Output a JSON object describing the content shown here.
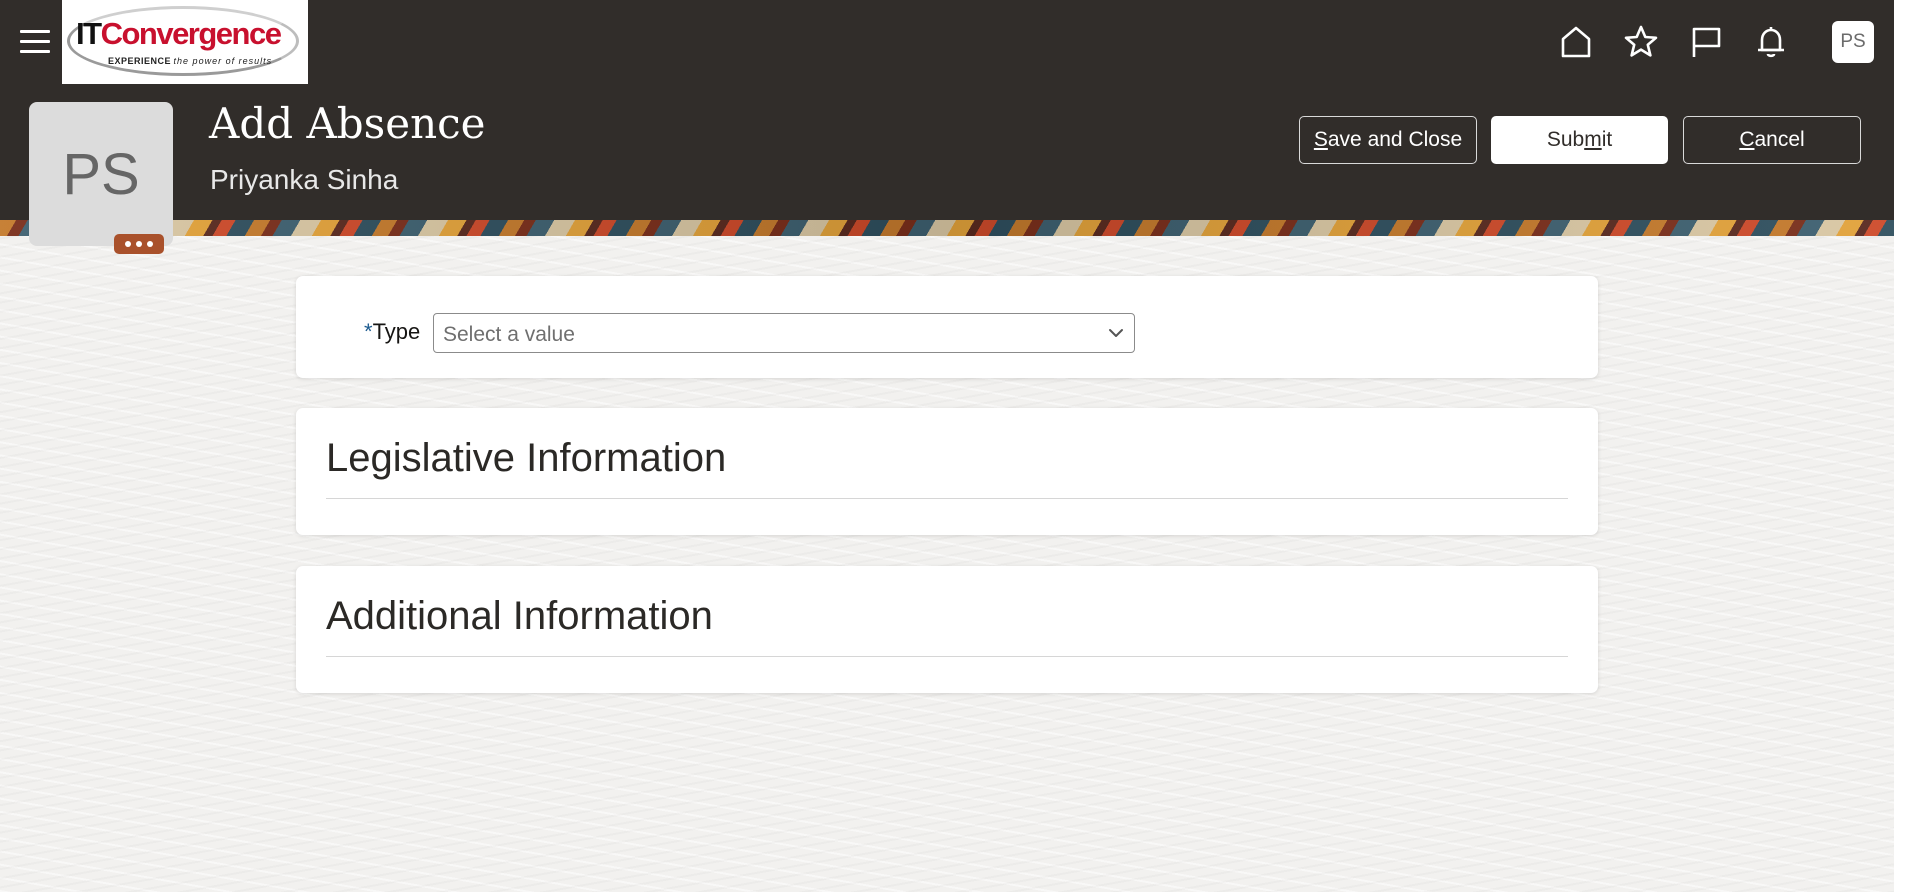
{
  "header": {
    "logo": {
      "brand_it": "IT",
      "brand_name": "Convergence",
      "tagline_bold": "EXPERIENCE",
      "tagline_rest": "the power of results"
    },
    "icons": [
      "hamburger-icon",
      "home-icon",
      "star-icon",
      "flag-icon",
      "bell-icon"
    ],
    "user_initials": "PS"
  },
  "person": {
    "initials": "PS",
    "page_title": "Add Absence",
    "name": "Priyanka Sinha"
  },
  "actions": {
    "save_and_close": {
      "pre": "",
      "mnemonic": "S",
      "post": "ave and Close"
    },
    "submit": {
      "pre": "Sub",
      "mnemonic": "m",
      "post": "it"
    },
    "cancel": {
      "pre": "",
      "mnemonic": "C",
      "post": "ancel"
    }
  },
  "form": {
    "type_required_marker": "*",
    "type_label": "Type",
    "type_placeholder": "Select a value"
  },
  "sections": {
    "legislative": "Legislative Information",
    "additional": "Additional Information"
  },
  "colors": {
    "header_bg": "#312d2a",
    "page_bg": "#f2f1ef",
    "avatar_more_bg": "#a9512b",
    "required_marker": "#1d5b8f"
  }
}
